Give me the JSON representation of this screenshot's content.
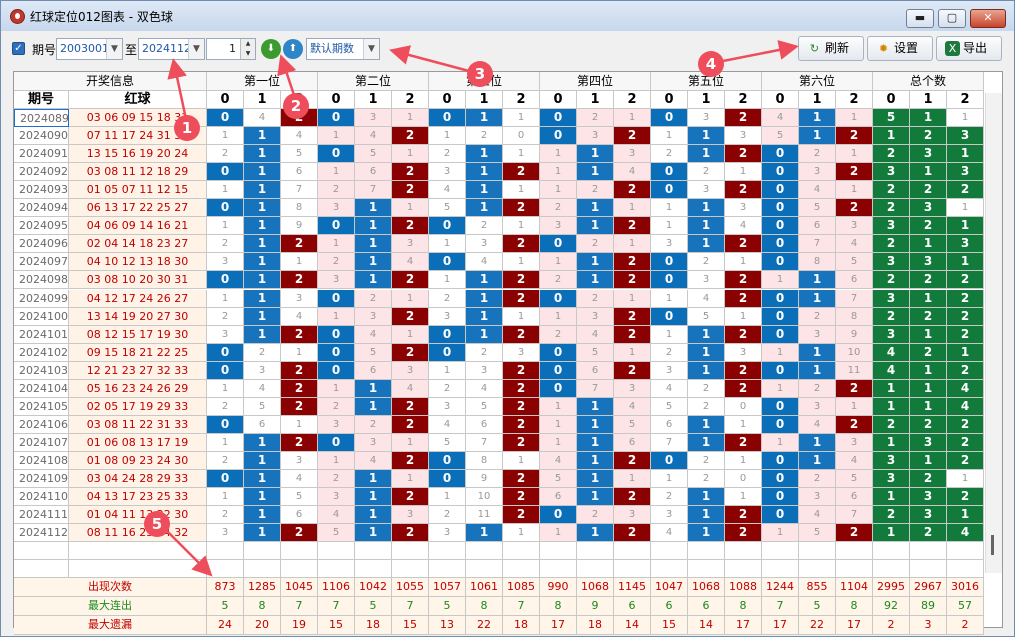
{
  "window": {
    "title": "红球定位012图表 - 双色球",
    "min": "▬",
    "max": "▢",
    "close": "✕"
  },
  "toolbar": {
    "period_label": "期号",
    "from_value": "2003001",
    "to_label": "至",
    "to_value": "2024112",
    "spin_value": "1",
    "preset": "默认期数",
    "refresh": "刷新",
    "settings": "设置",
    "export": "导出"
  },
  "headers": {
    "info": "开奖信息",
    "issue": "期号",
    "red": "红球",
    "groups": [
      "第一位",
      "第二位",
      "第三位",
      "第四位",
      "第五位",
      "第六位",
      "总个数"
    ],
    "sub": [
      "0",
      "1",
      "2"
    ]
  },
  "rows": [
    {
      "issue": "2024089",
      "red": "03 06 09 15 18 31",
      "c": [
        "0;4;2",
        "0;3;1",
        "0;1;1",
        "0;2;1",
        "0;3;2",
        "4;1;1",
        "5;1;1"
      ]
    },
    {
      "issue": "2024090",
      "red": "07 11 17 24 31 33",
      "c": [
        "1;1;4",
        "1;4;2",
        "1;2;0",
        "0;3;2",
        "1;1;3",
        "5;1;2",
        "1;2;3"
      ]
    },
    {
      "issue": "2024091",
      "red": "13 15 16 19 20 24",
      "c": [
        "2;1;5",
        "0;5;1",
        "2;1;1",
        "1;1;3",
        "2;1;2",
        "0;2;1",
        "2;3;1"
      ]
    },
    {
      "issue": "2024092",
      "red": "03 08 11 12 18 29",
      "c": [
        "0;1;6",
        "1;6;2",
        "3;1;2",
        "1;1;4",
        "0;2;1",
        "0;3;2",
        "3;1;3"
      ]
    },
    {
      "issue": "2024093",
      "red": "01 05 07 11 12 15",
      "c": [
        "1;1;7",
        "2;7;2",
        "4;1;1",
        "1;2;2",
        "0;3;2",
        "0;4;1",
        "2;2;2"
      ]
    },
    {
      "issue": "2024094",
      "red": "06 13 17 22 25 27",
      "c": [
        "0;1;8",
        "3;1;1",
        "5;1;2",
        "2;1;1",
        "1;1;3",
        "0;5;2",
        "2;3;1"
      ]
    },
    {
      "issue": "2024095",
      "red": "04 06 09 14 16 21",
      "c": [
        "1;1;9",
        "0;1;2",
        "0;2;1",
        "3;1;2",
        "1;1;4",
        "0;6;3",
        "3;2;1"
      ]
    },
    {
      "issue": "2024096",
      "red": "02 04 14 18 23 27",
      "c": [
        "2;1;2",
        "1;1;3",
        "1;3;2",
        "0;2;1",
        "3;1;2",
        "0;7;4",
        "2;1;3"
      ]
    },
    {
      "issue": "2024097",
      "red": "04 10 12 13 18 30",
      "c": [
        "3;1;1",
        "2;1;4",
        "0;4;1",
        "1;1;2",
        "0;2;1",
        "0;8;5",
        "3;3;1"
      ]
    },
    {
      "issue": "2024098",
      "red": "03 08 10 20 30 31",
      "c": [
        "0;1;2",
        "3;1;2",
        "1;1;2",
        "2;1;2",
        "0;3;2",
        "1;1;6",
        "2;2;2"
      ]
    },
    {
      "issue": "2024099",
      "red": "04 12 17 24 26 27",
      "c": [
        "1;1;3",
        "0;2;1",
        "2;1;2",
        "0;2;1",
        "1;4;2",
        "0;1;7",
        "3;1;2"
      ]
    },
    {
      "issue": "2024100",
      "red": "13 14 19 20 27 30",
      "c": [
        "2;1;4",
        "1;3;2",
        "3;1;1",
        "1;3;2",
        "0;5;1",
        "0;2;8",
        "2;2;2"
      ]
    },
    {
      "issue": "2024101",
      "red": "08 12 15 17 19 30",
      "c": [
        "3;1;2",
        "0;4;1",
        "0;1;2",
        "2;4;2",
        "1;1;2",
        "0;3;9",
        "3;1;2"
      ]
    },
    {
      "issue": "2024102",
      "red": "09 15 18 21 22 25",
      "c": [
        "0;2;1",
        "0;5;2",
        "0;2;3",
        "0;5;1",
        "2;1;3",
        "1;1;10",
        "4;2;1"
      ]
    },
    {
      "issue": "2024103",
      "red": "12 21 23 27 32 33",
      "c": [
        "0;3;2",
        "0;6;3",
        "1;3;2",
        "0;6;2",
        "3;1;2",
        "0;1;11",
        "4;1;2"
      ]
    },
    {
      "issue": "2024104",
      "red": "05 16 23 24 26 29",
      "c": [
        "1;4;2",
        "1;1;4",
        "2;4;2",
        "0;7;3",
        "4;2;2",
        "1;2;2",
        "1;1;4"
      ]
    },
    {
      "issue": "2024105",
      "red": "02 05 17 19 29 33",
      "c": [
        "2;5;2",
        "2;1;2",
        "3;5;2",
        "1;1;4",
        "5;2;0",
        "0;3;1",
        "1;1;4"
      ]
    },
    {
      "issue": "2024106",
      "red": "03 08 11 22 31 33",
      "c": [
        "0;6;1",
        "3;2;2",
        "4;6;2",
        "1;1;5",
        "6;1;1",
        "0;4;2",
        "2;2;2"
      ]
    },
    {
      "issue": "2024107",
      "red": "01 06 08 13 17 19",
      "c": [
        "1;1;2",
        "0;3;1",
        "5;7;2",
        "1;1;6",
        "7;1;2",
        "1;1;3",
        "1;3;2"
      ]
    },
    {
      "issue": "2024108",
      "red": "01 08 09 23 24 30",
      "c": [
        "2;1;3",
        "1;4;2",
        "0;8;1",
        "4;1;2",
        "0;2;1",
        "0;1;4",
        "3;1;2"
      ]
    },
    {
      "issue": "2024109",
      "red": "03 04 24 28 29 33",
      "c": [
        "0;1;4",
        "2;1;1",
        "0;9;2",
        "5;1;1",
        "1;2;0",
        "0;2;5",
        "3;2;1"
      ]
    },
    {
      "issue": "2024110",
      "red": "04 13 17 23 25 33",
      "c": [
        "1;1;5",
        "3;1;2",
        "1;10;2",
        "6;1;2",
        "2;1;1",
        "0;3;6",
        "1;3;2"
      ]
    },
    {
      "issue": "2024111",
      "red": "01 04 11 13 22 30",
      "c": [
        "2;1;6",
        "4;1;3",
        "2;11;2",
        "0;2;3",
        "3;1;2",
        "0;4;7",
        "2;3;1"
      ]
    },
    {
      "issue": "2024112",
      "red": "08 11 16 23 24 32",
      "c": [
        "3;1;2",
        "5;1;2",
        "3;1;1",
        "1;1;2",
        "4;1;2",
        "1;5;2",
        "1;2;4"
      ]
    }
  ],
  "stats": [
    {
      "label": "出现次数",
      "color": "#c00000",
      "vals": [
        "873",
        "1285",
        "1045",
        "1106",
        "1042",
        "1055",
        "1057",
        "1061",
        "1085",
        "990",
        "1068",
        "1145",
        "1047",
        "1068",
        "1088",
        "1244",
        "855",
        "1104",
        "2995",
        "2967",
        "3016"
      ]
    },
    {
      "label": "最大连出",
      "color": "#1a8a1a",
      "vals": [
        "5",
        "8",
        "7",
        "7",
        "5",
        "7",
        "5",
        "8",
        "7",
        "8",
        "9",
        "6",
        "6",
        "6",
        "8",
        "7",
        "5",
        "8",
        "92",
        "89",
        "57"
      ]
    },
    {
      "label": "最大遗漏",
      "color": "#c00000",
      "vals": [
        "24",
        "20",
        "19",
        "15",
        "18",
        "15",
        "13",
        "22",
        "18",
        "17",
        "18",
        "14",
        "15",
        "14",
        "17",
        "17",
        "22",
        "17",
        "2",
        "3",
        "2"
      ]
    }
  ],
  "annotations": [
    "1",
    "2",
    "3",
    "4",
    "5"
  ],
  "colors": {
    "zero": "#0a6fb8",
    "one": "#1773bb",
    "two": "#8b0000",
    "total": "#127a3a",
    "annot": "#ee4d5b"
  }
}
